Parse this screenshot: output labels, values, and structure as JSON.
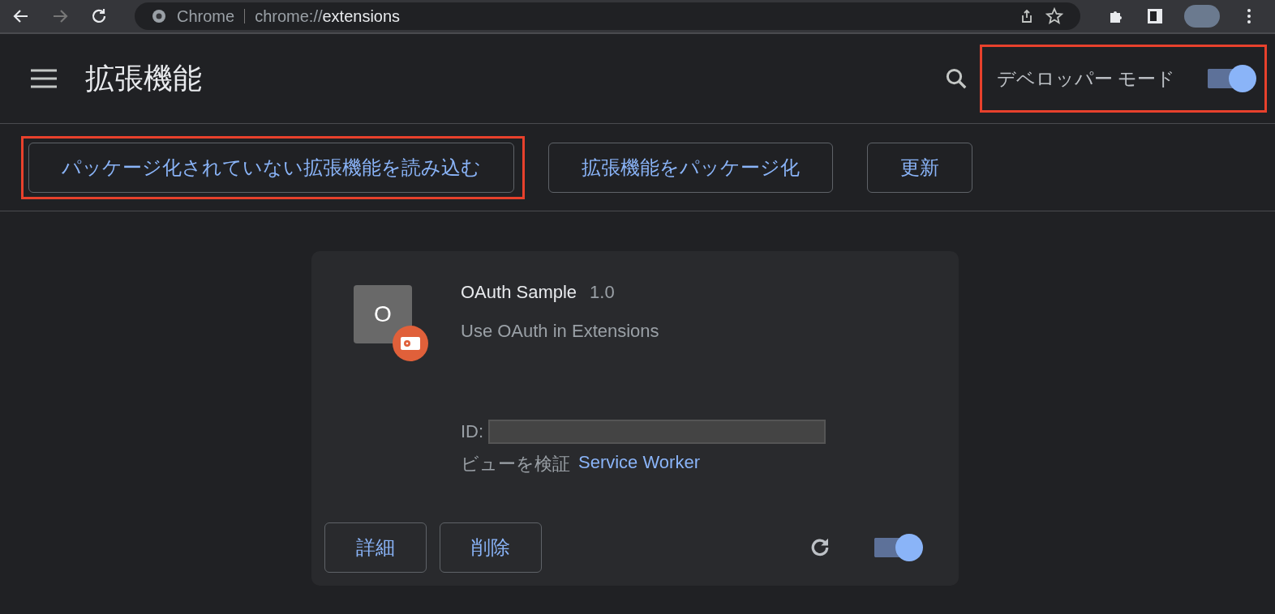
{
  "browser_toolbar": {
    "site_label": "Chrome",
    "url_prefix": "chrome://",
    "url_path": "extensions"
  },
  "header": {
    "title": "拡張機能",
    "developer_mode": {
      "label": "デベロッパー モード",
      "on": true,
      "highlighted": true
    }
  },
  "dev_actions": [
    {
      "label": "パッケージ化されていない拡張機能を読み込む",
      "highlighted": true
    },
    {
      "label": "拡張機能をパッケージ化",
      "highlighted": false
    },
    {
      "label": "更新",
      "highlighted": false
    }
  ],
  "extension_card": {
    "icon_letter": "O",
    "name": "OAuth Sample",
    "version": "1.0",
    "description": "Use OAuth in Extensions",
    "id_label": "ID:",
    "inspect_label": "ビューを検証",
    "inspect_link": "Service Worker",
    "buttons": [
      "詳細",
      "削除"
    ],
    "enabled": true
  }
}
